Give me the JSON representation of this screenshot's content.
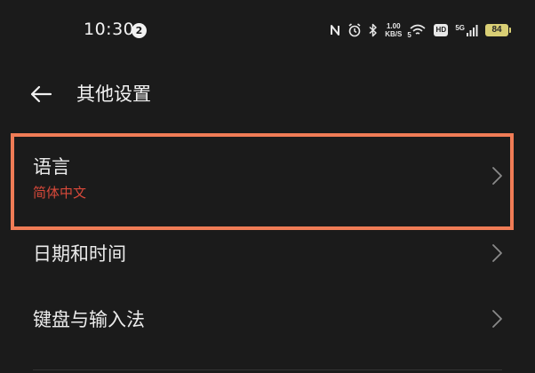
{
  "status_bar": {
    "time": "10:30",
    "notification_count": "2",
    "net_speed_value": "1.00",
    "net_speed_unit": "KB/S",
    "wifi_label": "5",
    "hd_label": "HD",
    "signal_label": "5G",
    "battery_level": "84",
    "battery_color": "#d9cf75"
  },
  "header": {
    "title": "其他设置"
  },
  "items": [
    {
      "title": "语言",
      "subtitle": "简体中文"
    },
    {
      "title": "日期和时间"
    },
    {
      "title": "键盘与输入法"
    }
  ],
  "colors": {
    "background": "#1b1b1b",
    "subtitle_accent": "#d8493a",
    "highlight_border": "#f07c56"
  }
}
